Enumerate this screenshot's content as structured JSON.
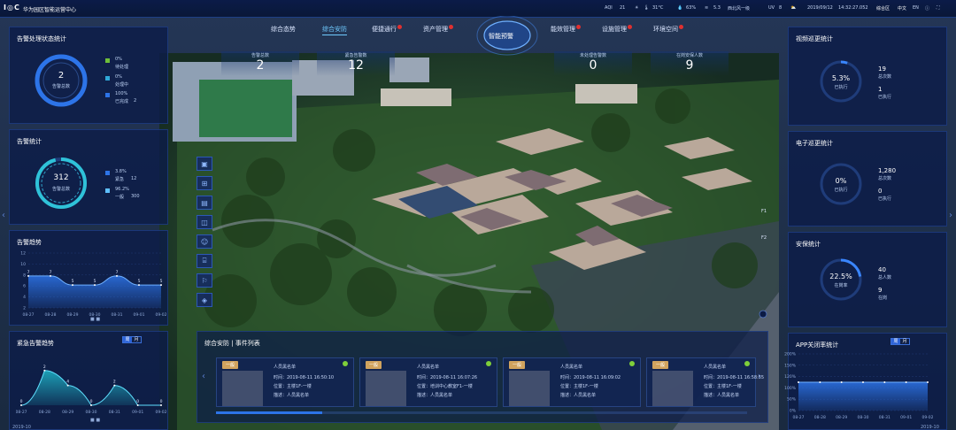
{
  "header": {
    "logo": "I◎C",
    "title": "华为园区智能运营中心",
    "weather": {
      "aqi_label": "AQI",
      "aqi": "21",
      "temp": "31°C",
      "humidity": "63%",
      "wind_value": "5.3",
      "wind": "西北风一级",
      "uv_label": "UV",
      "uv": "8"
    },
    "date": "2019/09/12",
    "time": "14:32:27.052",
    "user": "综合区",
    "lang_zh": "中文",
    "lang_en": "EN"
  },
  "nav": {
    "items": [
      {
        "label": "综合态势",
        "badge": false
      },
      {
        "label": "综合安防",
        "badge": false,
        "active": true
      },
      {
        "label": "便捷通行",
        "badge": true
      },
      {
        "label": "资产管理",
        "badge": true
      },
      {
        "label": "智能预警",
        "badge": false,
        "center": true
      },
      {
        "label": "能效管理",
        "badge": true
      },
      {
        "label": "设施管理",
        "badge": true
      },
      {
        "label": "环境空间",
        "badge": true
      }
    ]
  },
  "stats": [
    {
      "label": "告警总数",
      "value": "2"
    },
    {
      "label": "紧急告警数",
      "value": "12"
    },
    {
      "label": "未处理告警数",
      "value": "0"
    },
    {
      "label": "在岗安保人数",
      "value": "9"
    }
  ],
  "left": {
    "alarm_status": {
      "title": "告警处理状态统计",
      "total": "2",
      "total_label": "告警总数",
      "items": [
        {
          "pct": "0%",
          "label": "待处理",
          "color": "#6fbf3a"
        },
        {
          "pct": "0%",
          "label": "处理中",
          "color": "#2fa8d8"
        },
        {
          "pct": "100%",
          "label": "已完成",
          "color": "#2d74e8",
          "count": "2"
        }
      ]
    },
    "alarm_stats": {
      "title": "告警统计",
      "total": "312",
      "total_label": "告警总数",
      "items": [
        {
          "pct": "3.8%",
          "label": "紧急",
          "count": "12",
          "color": "#2d74e8"
        },
        {
          "pct": "96.2%",
          "label": "一般",
          "count": "300",
          "color": "#5fc0ff"
        }
      ]
    },
    "alarm_trend": {
      "title": "告警趋势",
      "yticks": [
        "12",
        "10",
        "8",
        "6",
        "4",
        "2"
      ]
    },
    "urgent_trend": {
      "title": "紧急告警趋势",
      "toggle": [
        "周",
        "月"
      ],
      "footer": "2019-10"
    }
  },
  "right": {
    "video_patrol": {
      "title": "视频巡更统计",
      "pct": "5.3%",
      "pct_label": "已执行",
      "total": "19",
      "total_label": "总次数",
      "done": "1",
      "done_label": "已执行"
    },
    "e_patrol": {
      "title": "电子巡更统计",
      "pct": "0%",
      "pct_label": "已执行",
      "total": "1,280",
      "total_label": "总次数",
      "done": "0",
      "done_label": "已执行"
    },
    "security": {
      "title": "安保统计",
      "pct": "22.5%",
      "pct_label": "在岗率",
      "total": "40",
      "total_label": "总人数",
      "done": "9",
      "done_label": "在岗"
    },
    "app_close": {
      "title": "APP关闭率统计",
      "toggle": [
        "周",
        "月"
      ],
      "yticks": [
        "200%",
        "150%",
        "120%",
        "100%",
        "50%",
        "0%"
      ],
      "footer": "2019-10"
    }
  },
  "events": {
    "title": "综合安防 | 事件列表",
    "cards": [
      {
        "tag": "一般",
        "name": "人员黑名单",
        "time": "时间：2019-08-11 16:50:10",
        "loc": "位置：主楼1F-一楼",
        "desc": "描述：人员黑名单"
      },
      {
        "tag": "一般",
        "name": "人员黑名单",
        "time": "时间：2019-08-11 16:07:26",
        "loc": "位置：培训中心教室F1-一楼",
        "desc": "描述：人员黑名单"
      },
      {
        "tag": "一般",
        "name": "人员黑名单",
        "time": "时间：2019-08-11 16:09:02",
        "loc": "位置：主楼1F-一楼",
        "desc": "描述：人员黑名单"
      },
      {
        "tag": "一般",
        "name": "人员黑名单",
        "time": "时间：2019-08-11 16:58:55",
        "loc": "位置：主楼1F-一楼",
        "desc": "描述：人员黑名单"
      }
    ]
  },
  "map_labels": [
    "F1",
    "F2"
  ],
  "chart_data": [
    {
      "type": "area",
      "title": "告警趋势",
      "categories": [
        "08-27",
        "08-28",
        "08-29",
        "08-30",
        "08-31",
        "09-01",
        "09-02"
      ],
      "values": [
        7,
        7,
        5,
        5,
        7,
        5,
        5
      ],
      "ylim": [
        0,
        12
      ],
      "data_labels": [
        "7",
        "7",
        "5",
        "5",
        "7",
        "5",
        "5"
      ]
    },
    {
      "type": "area",
      "title": "紧急告警趋势",
      "categories": [
        "08-27",
        "08-28",
        "08-29",
        "08-30",
        "08-31",
        "09-01",
        "09-02"
      ],
      "values": [
        0,
        3.5,
        2,
        0,
        2,
        0,
        0
      ],
      "data_labels": [
        "0",
        "2",
        "4",
        "0",
        "2",
        "0",
        "0"
      ],
      "ylim": [
        0,
        5
      ]
    },
    {
      "type": "area",
      "title": "APP关闭率统计",
      "categories": [
        "08-27",
        "08-28",
        "08-29",
        "08-30",
        "08-31",
        "09-01",
        "09-02"
      ],
      "values": [
        100,
        100,
        100,
        100,
        100,
        100,
        100
      ],
      "ylim": [
        0,
        200
      ]
    }
  ]
}
